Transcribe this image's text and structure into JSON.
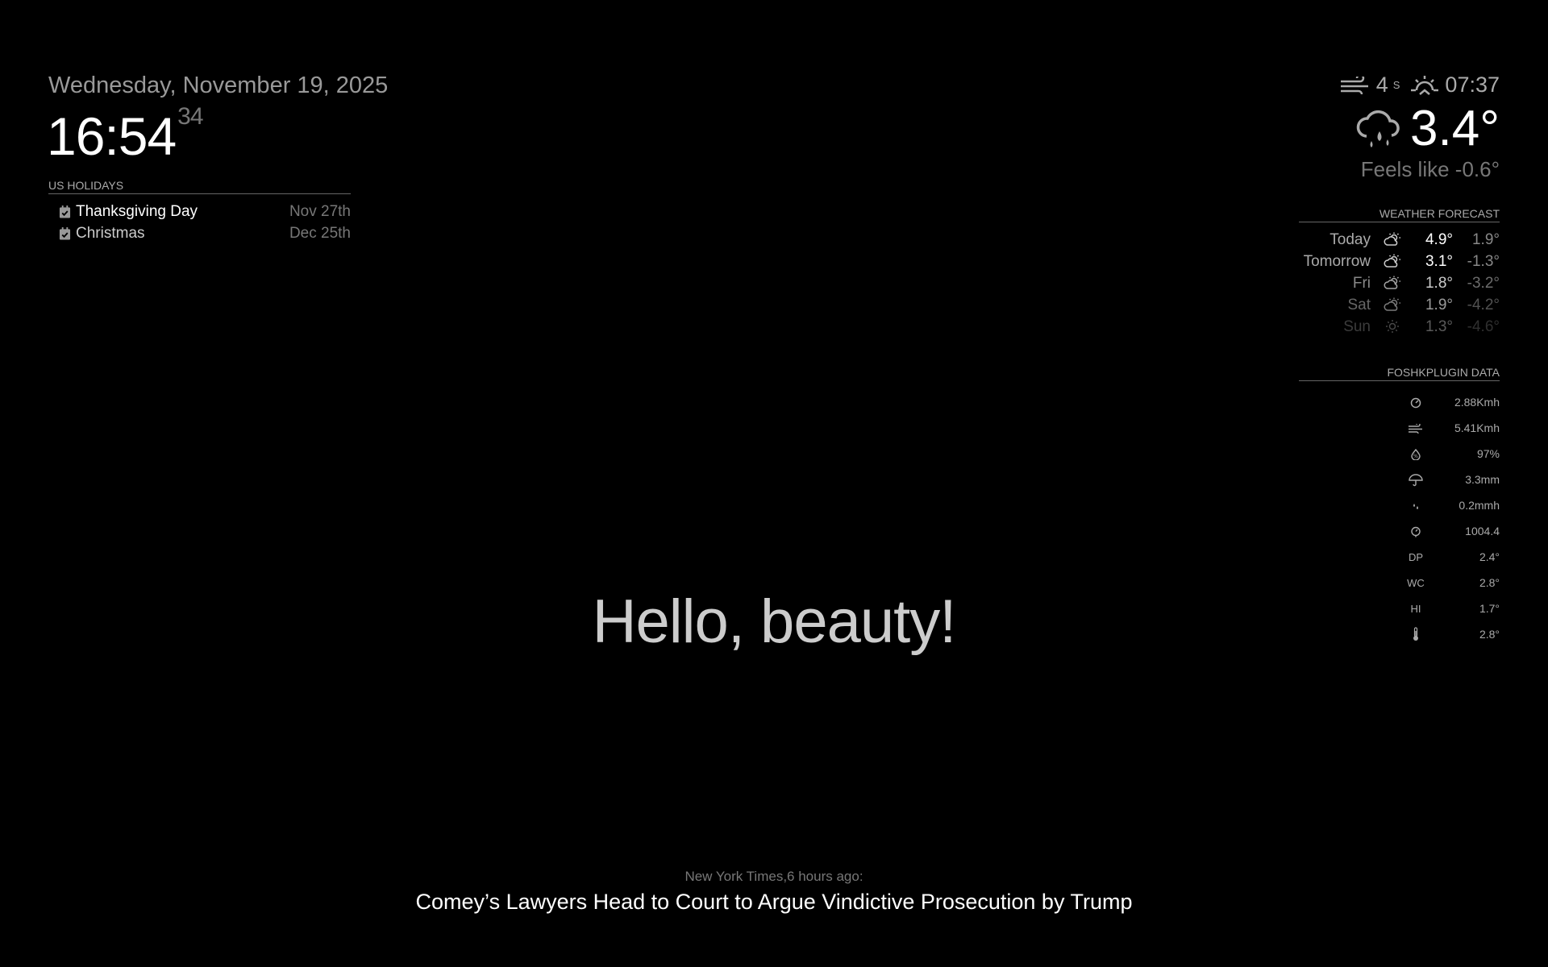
{
  "clock": {
    "date": "Wednesday, November 19, 2025",
    "time": "16:54",
    "seconds": "34"
  },
  "holidays": {
    "header": "US Holidays",
    "items": [
      {
        "title": "Thanksgiving Day",
        "date": "Nov 27th",
        "icon": "calendar-check-icon"
      },
      {
        "title": "Christmas",
        "date": "Dec 25th",
        "icon": "calendar-check-icon"
      }
    ]
  },
  "weather_current": {
    "wind_speed": "4",
    "wind_dir": "S",
    "sunrise_time": "07:37",
    "temperature": "3.4°",
    "feels_like": "Feels like -0.6°",
    "icons": {
      "wind": "wind-icon",
      "sunrise": "sunrise-icon",
      "condition": "cloud-rain-icon"
    }
  },
  "forecast": {
    "header": "Weather Forecast",
    "days": [
      {
        "day": "Today",
        "max": "4.9°",
        "min": "1.9°",
        "icon": "partly-cloudy-icon",
        "opacity": 1.0
      },
      {
        "day": "Tomorrow",
        "max": "3.1°",
        "min": "-1.3°",
        "icon": "partly-cloudy-icon",
        "opacity": 1.0
      },
      {
        "day": "Fri",
        "max": "1.8°",
        "min": "-3.2°",
        "icon": "partly-cloudy-icon",
        "opacity": 0.8
      },
      {
        "day": "Sat",
        "max": "1.9°",
        "min": "-4.2°",
        "icon": "partly-cloudy-icon",
        "opacity": 0.6
      },
      {
        "day": "Sun",
        "max": "1.3°",
        "min": "-4.6°",
        "icon": "sun-icon",
        "opacity": 0.35
      }
    ]
  },
  "foshk": {
    "header": "FoshkPlugin Data",
    "rows": [
      {
        "icon": "gauge-icon",
        "label": "",
        "value": "2.88Kmh"
      },
      {
        "icon": "wind-gust-icon",
        "label": "",
        "value": "5.41Kmh"
      },
      {
        "icon": "humidity-icon",
        "label": "",
        "value": "97%"
      },
      {
        "icon": "umbrella-icon",
        "label": "",
        "value": "3.3mm"
      },
      {
        "icon": "raindrops-icon",
        "label": "",
        "value": "0.2mmh"
      },
      {
        "icon": "barometer-icon",
        "label": "",
        "value": "1004.4"
      },
      {
        "icon": "",
        "label": "DP",
        "value": "2.4°"
      },
      {
        "icon": "",
        "label": "WC",
        "value": "2.8°"
      },
      {
        "icon": "",
        "label": "HI",
        "value": "1.7°"
      },
      {
        "icon": "thermometer-icon",
        "label": "",
        "value": "2.8°"
      }
    ]
  },
  "compliment": "Hello, beauty!",
  "news": {
    "source": "New York Times,6 hours ago:",
    "title": "Comey’s Lawyers Head to Court to Argue Vindictive Prosecution by Trump"
  }
}
